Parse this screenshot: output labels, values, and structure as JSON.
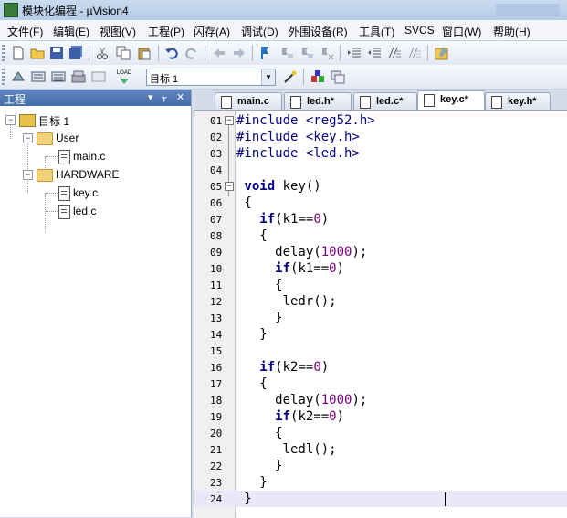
{
  "window": {
    "title": "模块化编程 - µVision4"
  },
  "menu": [
    "文件(F)",
    "编辑(E)",
    "视图(V)",
    "工程(P)",
    "闪存(A)",
    "调试(D)",
    "外围设备(R)",
    "工具(T)",
    "SVCS",
    "窗口(W)",
    "帮助(H)"
  ],
  "toolbar2": {
    "target_label": "目标 1",
    "load_label": "LOAD"
  },
  "project_panel": {
    "title": "工程",
    "root": "目标 1",
    "groups": [
      {
        "name": "User",
        "files": [
          "main.c"
        ]
      },
      {
        "name": "HARDWARE",
        "files": [
          "key.c",
          "led.c"
        ]
      }
    ]
  },
  "tabs": [
    {
      "label": "main.c",
      "active": false
    },
    {
      "label": "led.h*",
      "active": false
    },
    {
      "label": "led.c*",
      "active": false
    },
    {
      "label": "key.c*",
      "active": true
    },
    {
      "label": "key.h*",
      "active": false
    }
  ],
  "code": [
    {
      "n": "01",
      "html": "<span class='pp'>#include &lt;reg52.h&gt;</span>"
    },
    {
      "n": "02",
      "html": "<span class='pp'>#include &lt;key.h&gt;</span>"
    },
    {
      "n": "03",
      "html": "<span class='pp'>#include &lt;led.h&gt;</span>"
    },
    {
      "n": "04",
      "html": ""
    },
    {
      "n": "05",
      "html": " <span class='kw'>void</span> key()"
    },
    {
      "n": "06",
      "html": " {"
    },
    {
      "n": "07",
      "html": "   <span class='kw'>if</span>(k1==<span class='num'>0</span>)"
    },
    {
      "n": "08",
      "html": "   {"
    },
    {
      "n": "09",
      "html": "     delay(<span class='num'>1000</span>);"
    },
    {
      "n": "10",
      "html": "     <span class='kw'>if</span>(k1==<span class='num'>0</span>)"
    },
    {
      "n": "11",
      "html": "     {"
    },
    {
      "n": "12",
      "html": "      ledr();"
    },
    {
      "n": "13",
      "html": "     }"
    },
    {
      "n": "14",
      "html": "   }"
    },
    {
      "n": "15",
      "html": ""
    },
    {
      "n": "16",
      "html": "   <span class='kw'>if</span>(k2==<span class='num'>0</span>)"
    },
    {
      "n": "17",
      "html": "   {"
    },
    {
      "n": "18",
      "html": "     delay(<span class='num'>1000</span>);"
    },
    {
      "n": "19",
      "html": "     <span class='kw'>if</span>(k2==<span class='num'>0</span>)"
    },
    {
      "n": "20",
      "html": "     {"
    },
    {
      "n": "21",
      "html": "      ledl();"
    },
    {
      "n": "22",
      "html": "     }"
    },
    {
      "n": "23",
      "html": "   }"
    },
    {
      "n": "24",
      "html": " }"
    }
  ],
  "colors": {
    "keyword": "#000080",
    "number": "#800080",
    "current_line": "#e8e8f8"
  }
}
